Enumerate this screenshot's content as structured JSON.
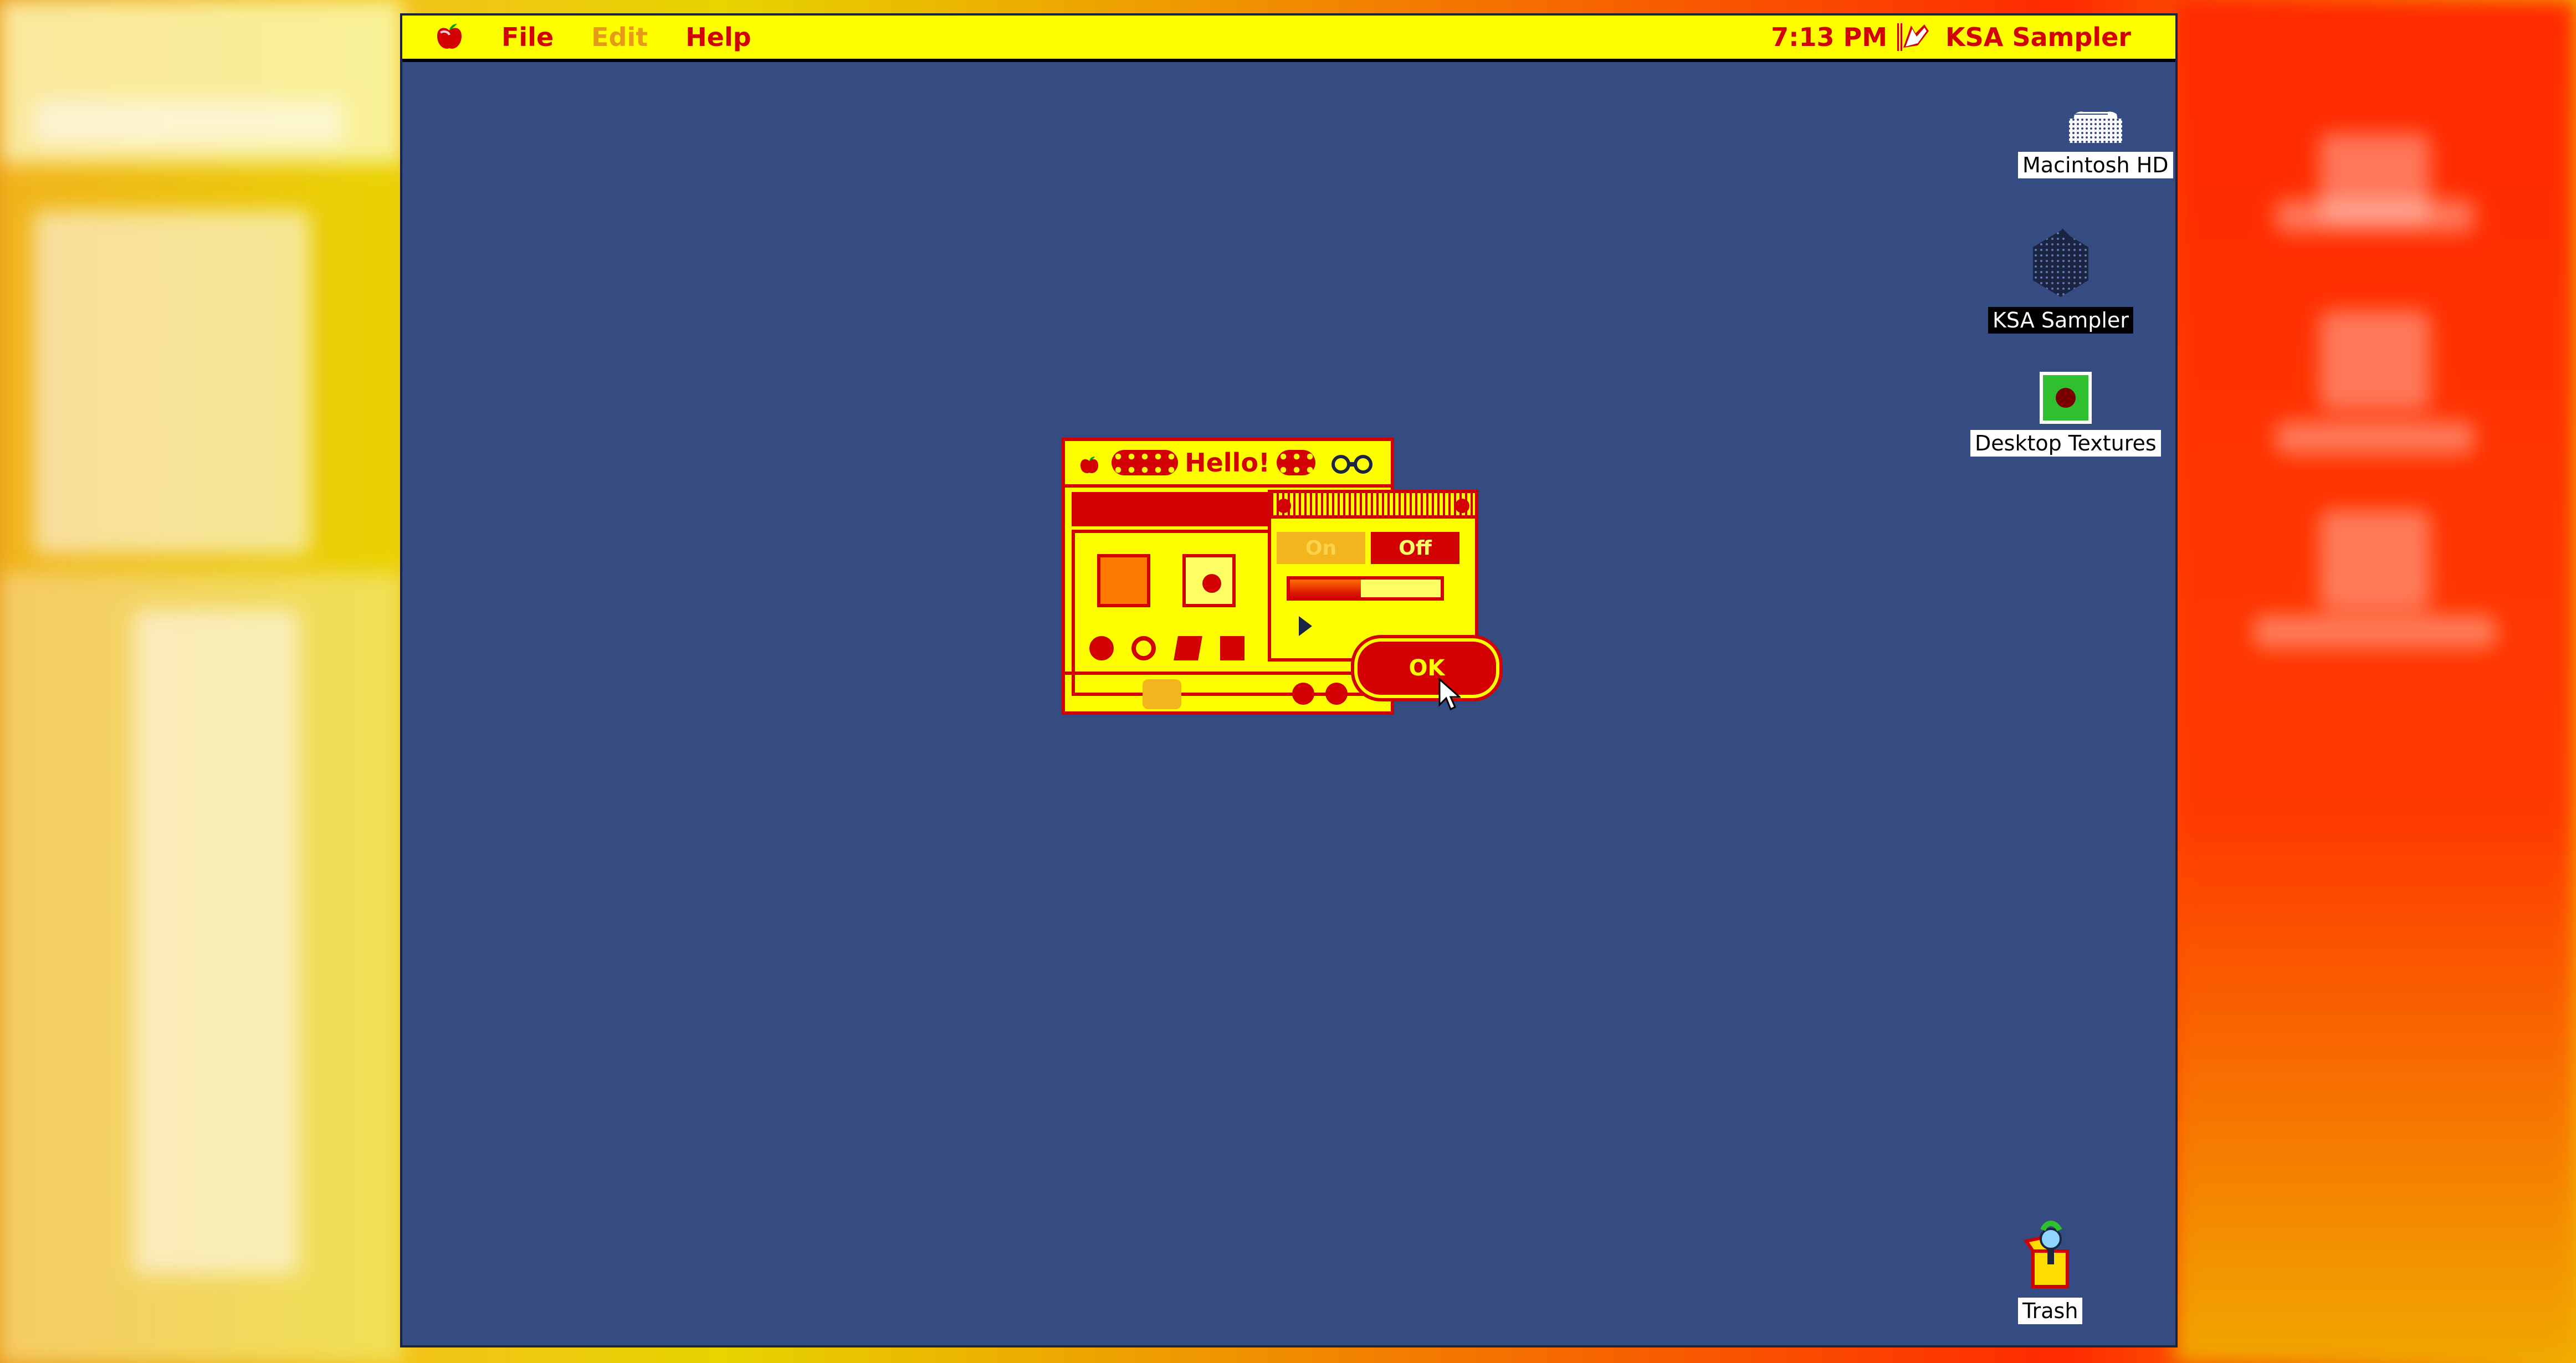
{
  "menubar": {
    "apple_menu": "apple-menu",
    "items": [
      {
        "label": "File",
        "enabled": true
      },
      {
        "label": "Edit",
        "enabled": false
      },
      {
        "label": "Help",
        "enabled": true
      }
    ],
    "clock": "7:13 PM",
    "app_name": "KSA Sampler"
  },
  "desktop_icons": [
    {
      "label": "Macintosh HD",
      "icon": "hard-drive-icon",
      "selected": false
    },
    {
      "label": "KSA Sampler",
      "icon": "app-icon",
      "selected": true
    },
    {
      "label": "Desktop Textures",
      "icon": "textures-icon",
      "selected": false
    },
    {
      "label": "Trash",
      "icon": "trash-icon",
      "selected": false
    }
  ],
  "dialog": {
    "title": "Hello!",
    "toggle_on": "On",
    "toggle_off": "Off",
    "ok_label": "OK",
    "slider_value": 0.47
  },
  "colors": {
    "menubar_bg": "#ffff00",
    "menubar_text": "#d20000",
    "desktop": "#344c82",
    "accent_red": "#d20000"
  }
}
